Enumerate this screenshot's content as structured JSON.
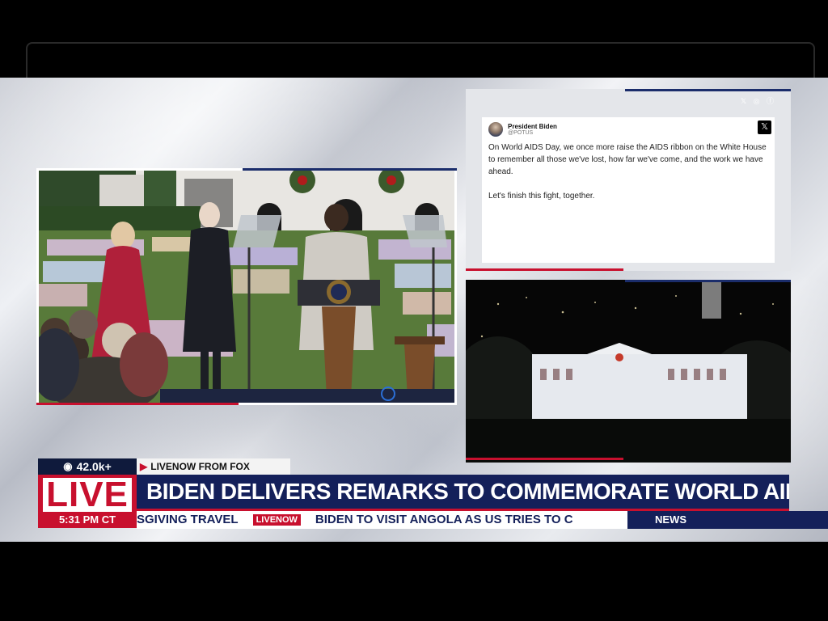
{
  "viewer_count": "42.0k+",
  "source_label": "LIVENOW FROM FOX",
  "live_badge": "LIVE",
  "time": "5:31 PM CT",
  "headline": "BIDEN DELIVERS REMARKS TO COMMEMORATE WORLD AIDS DAY",
  "ticker": {
    "segment_a": "SGIVING TRAVEL",
    "logo": "LIVENOW",
    "segment_b": "BIDEN TO VISIT ANGOLA AS US TRIES TO C"
  },
  "news_label": "NEWS",
  "tweet": {
    "name": "President Biden",
    "handle": "@POTUS",
    "x_logo": "𝕏",
    "text": "On World AIDS Day, we once more raise the AIDS ribbon on the White House to remember all those we've lost, how far we've come, and the work we have ahead.\n\nLet's finish this fight, together."
  },
  "social_icons": "𝕏 ◎ ⓕ",
  "colors": {
    "brand_red": "#c8102e",
    "brand_navy": "#14205a",
    "badge_navy": "#0f1a3c"
  },
  "icons": [
    "eye-icon",
    "play-triangle-icon",
    "x-logo-icon",
    "instagram-icon",
    "facebook-icon"
  ]
}
